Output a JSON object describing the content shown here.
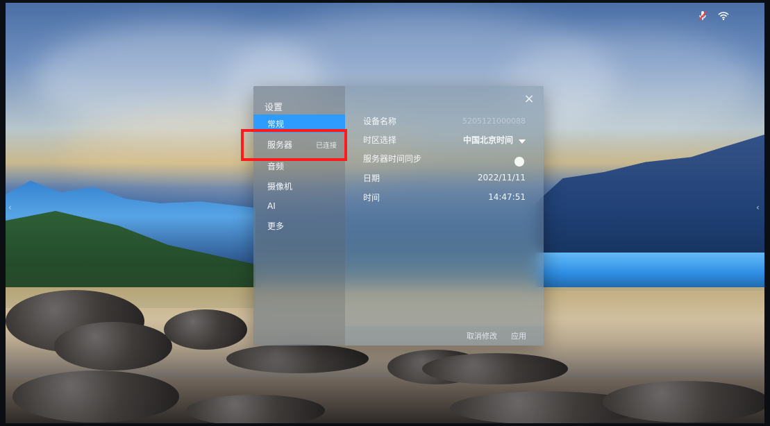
{
  "status_bar": {
    "icons": [
      {
        "name": "mic-muted-icon",
        "color": "#ff3b30"
      },
      {
        "name": "wifi-icon",
        "color": "#ffffff"
      }
    ]
  },
  "settings": {
    "title": "设置",
    "close_symbol": "×",
    "menu": [
      {
        "label": "常规",
        "selected": true
      },
      {
        "label": "服务器",
        "status": "已连接"
      },
      {
        "label": "音频"
      },
      {
        "label": "摄像机"
      },
      {
        "label": "AI"
      },
      {
        "label": "更多"
      }
    ],
    "fields": [
      {
        "label": "设备名称",
        "value": "5205121000088"
      },
      {
        "label": "时区选择",
        "value": "中国北京时间"
      },
      {
        "label": "服务器时间同步",
        "toggle": true
      },
      {
        "label": "日期",
        "value": "2022/11/11"
      },
      {
        "label": "时间",
        "value": "14:47:51"
      }
    ],
    "footer": {
      "cancel": "取消修改",
      "apply": "应用"
    }
  }
}
